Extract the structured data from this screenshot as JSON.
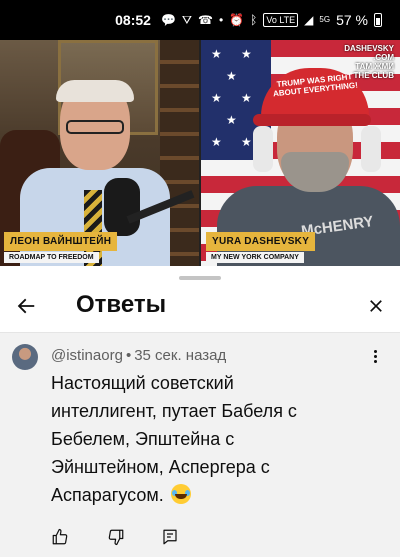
{
  "status_bar": {
    "time": "08:52",
    "battery_percent": "57 %",
    "volte": "Vo LTE",
    "network": "5G"
  },
  "video": {
    "left_speaker": {
      "name": "ЛЕОН ВАЙНШТЕЙН",
      "subtitle": "ROADMAP TO FREEDOM"
    },
    "right_speaker": {
      "name": "YURA DASHEVSKY",
      "subtitle": "MY NEW YORK COMPANY"
    },
    "cap_text": "TRUMP WAS RIGHT ABOUT EVERYTHING!",
    "shirt_text": "McHENRY",
    "watermark_lines": [
      "DASHEVSKY",
      ".COM",
      "ТАМ ЖМИ",
      "THE CLUB"
    ]
  },
  "sheet": {
    "title": "Ответы"
  },
  "comment": {
    "author": "@istinaorg",
    "separator": "•",
    "time": "35 сек. назад",
    "text": "Настоящий советский интеллигент, путает Бабеля с Бебелем, Эпштейна с Эйнштейном, Аспергера с Аспарагусом."
  },
  "colors": {
    "name_tag_bg": "#e6b53d",
    "comment_bg": "#f2f2f2",
    "icon": "#0f0f0f"
  },
  "icons": [
    "back-arrow-icon",
    "close-icon",
    "more-vert-icon",
    "thumbs-up-icon",
    "thumbs-down-icon",
    "reply-icon",
    "laughing-emoji-icon"
  ]
}
